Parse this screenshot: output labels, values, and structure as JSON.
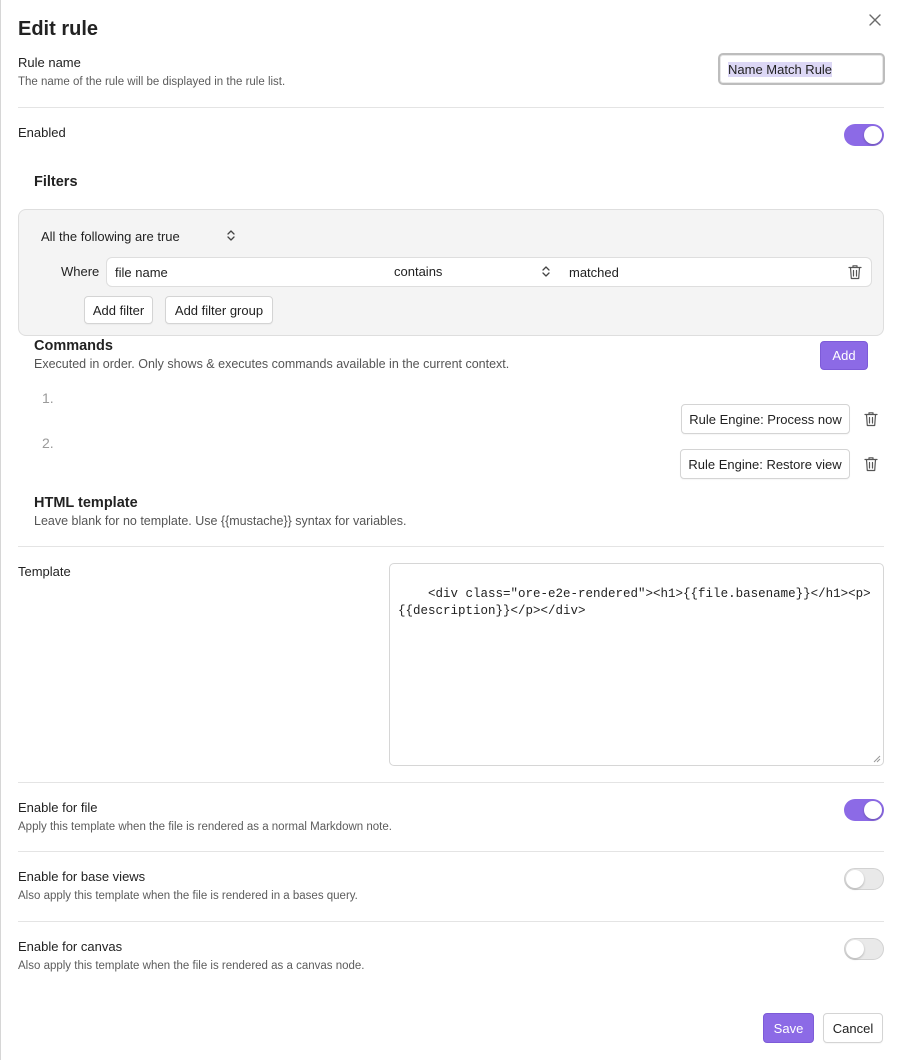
{
  "dialog": {
    "title": "Edit rule"
  },
  "rule_name": {
    "label": "Rule name",
    "description": "The name of the rule will be displayed in the rule list.",
    "value": "Name Match Rule"
  },
  "enabled": {
    "label": "Enabled",
    "state": "on"
  },
  "filters": {
    "heading": "Filters",
    "group_mode": "All the following are true",
    "rows": [
      {
        "prefix": "Where",
        "field": "file name",
        "operator": "contains",
        "value": "matched"
      }
    ],
    "add_filter_label": "Add filter",
    "add_filter_group_label": "Add filter group"
  },
  "commands": {
    "heading": "Commands",
    "description": "Executed in order. Only shows & executes commands available in the current context.",
    "add_label": "Add",
    "items": [
      {
        "number": "1.",
        "label": "Rule Engine: Process now"
      },
      {
        "number": "2.",
        "label": "Rule Engine: Restore view"
      }
    ]
  },
  "html_template": {
    "heading": "HTML template",
    "description": "Leave blank for no template. Use {{mustache}} syntax for variables.",
    "template_label": "Template",
    "template_value": "<div class=\"ore-e2e-rendered\"><h1>{{file.basename}}</h1><p>{{description}}</p></div>"
  },
  "enable_for_file": {
    "label": "Enable for file",
    "description": "Apply this template when the file is rendered as a normal Markdown note.",
    "state": "on"
  },
  "enable_for_base_views": {
    "label": "Enable for base views",
    "description": "Also apply this template when the file is rendered in a bases query.",
    "state": "off"
  },
  "enable_for_canvas": {
    "label": "Enable for canvas",
    "description": "Also apply this template when the file is rendered as a canvas node.",
    "state": "off"
  },
  "footer": {
    "save_label": "Save",
    "cancel_label": "Cancel"
  },
  "theme": {
    "accent": "#8c6ae6",
    "toggle_off": "#e9e9e9",
    "filter_box_bg": "#f4f4f4"
  },
  "icons": {
    "close": "close-icon",
    "chevron_updown": "chevron-up-down-icon",
    "trash": "trash-icon"
  }
}
